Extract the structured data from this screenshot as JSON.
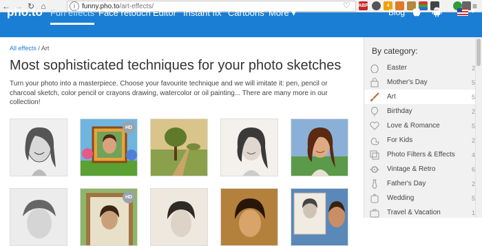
{
  "browser": {
    "url_host": "funny.pho.to",
    "url_path": "/art-effects/",
    "ext_badge_abp": "ABP",
    "ext_badge_count": "4"
  },
  "nav": {
    "logo": "pho.to",
    "items": [
      {
        "label": "Fun effects"
      },
      {
        "label": "Face retouch"
      },
      {
        "label": "Editor"
      },
      {
        "label": "Instant fix"
      },
      {
        "label": "Cartoons"
      },
      {
        "label": "More ▾"
      }
    ],
    "blog": "Blog"
  },
  "breadcrumb": {
    "root": "All effects",
    "sep": "/",
    "current": "Art"
  },
  "page": {
    "title": "Most sophisticated techniques for your photo sketches",
    "description": "Turn your photo into a masterpiece. Choose your favourite technique and we will imitate it: pen, pencil or charcoal sketch, color pencil or crayons drawing, watercolor or oil painting... There are many more in our collection!"
  },
  "thumbs": {
    "hd_label": "HD",
    "items": [
      {
        "style": "pencil",
        "hd": false
      },
      {
        "style": "frame-green",
        "hd": true
      },
      {
        "style": "painting",
        "hd": false
      },
      {
        "style": "sketch",
        "hd": false
      },
      {
        "style": "color-pencil",
        "hd": false
      },
      {
        "style": "pencil",
        "hd": false
      },
      {
        "style": "frame-wood",
        "hd": true
      },
      {
        "style": "sketch",
        "hd": false
      },
      {
        "style": "oil",
        "hd": false
      },
      {
        "style": "collage",
        "hd": false
      }
    ]
  },
  "sidebar": {
    "title": "By category:",
    "categories": [
      {
        "label": "Easter",
        "count": "2",
        "icon": "egg-icon"
      },
      {
        "label": "Mother's Day",
        "count": "5",
        "icon": "bag-icon"
      },
      {
        "label": "Art",
        "count": "5",
        "icon": "brush-icon",
        "selected": true
      },
      {
        "label": "Birthday",
        "count": "2",
        "icon": "balloon-icon"
      },
      {
        "label": "Love & Romance",
        "count": "5",
        "icon": "heart-icon"
      },
      {
        "label": "For Kids",
        "count": "2",
        "icon": "duck-icon"
      },
      {
        "label": "Photo Filters & Effects",
        "count": "4",
        "icon": "filters-icon"
      },
      {
        "label": "Vintage & Retro",
        "count": "6",
        "icon": "film-icon"
      },
      {
        "label": "Father's Day",
        "count": "2",
        "icon": "tie-icon"
      },
      {
        "label": "Wedding",
        "count": "5",
        "icon": "ring-icon"
      },
      {
        "label": "Travel & Vacation",
        "count": "1",
        "icon": "suitcase-icon"
      }
    ]
  }
}
